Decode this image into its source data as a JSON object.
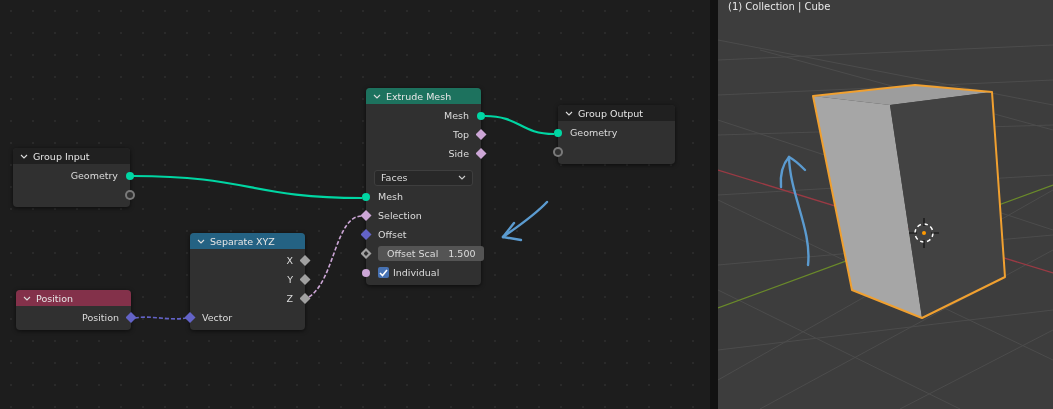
{
  "node_editor": {
    "nodes": [
      {
        "title": "Group Input",
        "color": "#202020",
        "items": [
          {
            "kind": "output",
            "label": "Geometry",
            "socket": {
              "kind": "circle",
              "color": "#00d6a3"
            }
          },
          {
            "kind": "output",
            "socket": {
              "kind": "ring",
              "color": "#7a7a7a"
            }
          }
        ]
      },
      {
        "title": "Position",
        "color": "#83314a",
        "items": [
          {
            "kind": "output",
            "label": "Position",
            "socket": {
              "kind": "diamond",
              "color": "#6363c7"
            }
          }
        ]
      },
      {
        "title": "Separate XYZ",
        "color": "#246283",
        "items": [
          {
            "kind": "output",
            "label": "X",
            "socket": {
              "kind": "diamond",
              "color": "#a1a1a1"
            }
          },
          {
            "kind": "output",
            "label": "Y",
            "socket": {
              "kind": "diamond",
              "color": "#a1a1a1"
            }
          },
          {
            "kind": "output",
            "label": "Z",
            "socket": {
              "kind": "diamond",
              "color": "#a1a1a1"
            }
          },
          {
            "kind": "input",
            "label": "Vector",
            "socket": {
              "kind": "diamond",
              "color": "#6363c7"
            }
          }
        ]
      },
      {
        "title": "Extrude Mesh",
        "color": "#1d725e",
        "items": [
          {
            "kind": "output",
            "label": "Mesh",
            "socket": {
              "kind": "circle",
              "color": "#00d6a3"
            }
          },
          {
            "kind": "output",
            "label": "Top",
            "socket": {
              "kind": "diamond",
              "color": "#cca6d6"
            }
          },
          {
            "kind": "output",
            "label": "Side",
            "socket": {
              "kind": "diamond",
              "color": "#cca6d6"
            }
          },
          {
            "kind": "dropdown",
            "value": "Faces"
          },
          {
            "kind": "input",
            "label": "Mesh",
            "socket": {
              "kind": "circle",
              "color": "#00d6a3"
            }
          },
          {
            "kind": "input",
            "label": "Selection",
            "socket": {
              "kind": "diamond",
              "color": "#cca6d6"
            }
          },
          {
            "kind": "input",
            "label": "Offset",
            "socket": {
              "kind": "diamond",
              "color": "#6363c7"
            }
          },
          {
            "kind": "field",
            "label": "Offset Scal",
            "value": "1.500",
            "socket": {
              "kind": "hollow-diamond",
              "color": "#a1a1a1"
            }
          },
          {
            "kind": "checkbox",
            "label": "Individual",
            "checked": true,
            "socket": {
              "kind": "circle",
              "color": "#cca6d6"
            }
          }
        ]
      },
      {
        "title": "Group Output",
        "color": "#202020",
        "items": [
          {
            "kind": "input",
            "label": "Geometry",
            "socket": {
              "kind": "circle",
              "color": "#00d6a3"
            }
          },
          {
            "kind": "input",
            "socket": {
              "kind": "ring",
              "color": "#7a7a7a"
            }
          }
        ]
      }
    ],
    "links": [
      {
        "color": "#00d6a3",
        "dashed": false
      },
      {
        "color": "#00d6a3",
        "dashed": false
      },
      {
        "color": "#6363c7",
        "dashed": true
      },
      {
        "color": "#cca6d6",
        "dashed": true
      }
    ]
  },
  "viewport": {
    "header": "(1) Collection | Cube"
  }
}
